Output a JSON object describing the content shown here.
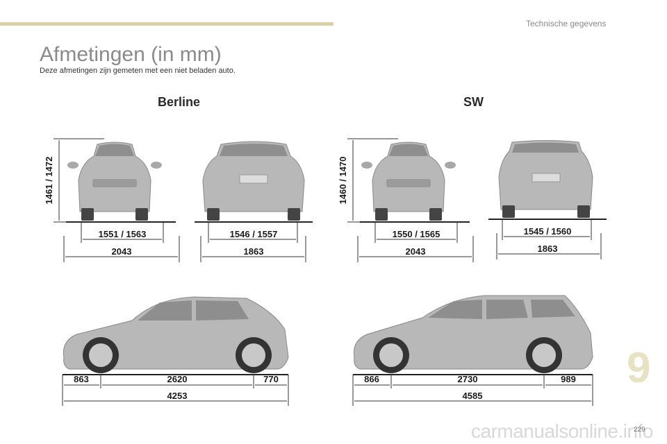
{
  "header": {
    "section_title": "Technische gegevens"
  },
  "title": "Afmetingen (in mm)",
  "subtitle": "Deze afmetingen zijn gemeten met een niet beladen auto.",
  "berline": {
    "label": "Berline",
    "height": "1461 / 1472",
    "front_track": "1551 / 1563",
    "front_width": "2043",
    "rear_track": "1546 / 1557",
    "rear_width": "1863",
    "front_overhang": "863",
    "wheelbase": "2620",
    "rear_overhang": "770",
    "length": "4253"
  },
  "sw": {
    "label": "SW",
    "height": "1460 / 1470",
    "front_track": "1550 / 1565",
    "front_width": "2043",
    "rear_track": "1545 / 1560",
    "rear_width": "1863",
    "front_overhang": "866",
    "wheelbase": "2730",
    "rear_overhang": "989",
    "length": "4585"
  },
  "footer": {
    "chapter": "9",
    "page": "229",
    "watermark": "carmanualsonline.info"
  },
  "colors": {
    "accent_rule": "#d9cfaa",
    "chapter_number": "#e8e2c4",
    "car_body": "#b8b8b8"
  }
}
